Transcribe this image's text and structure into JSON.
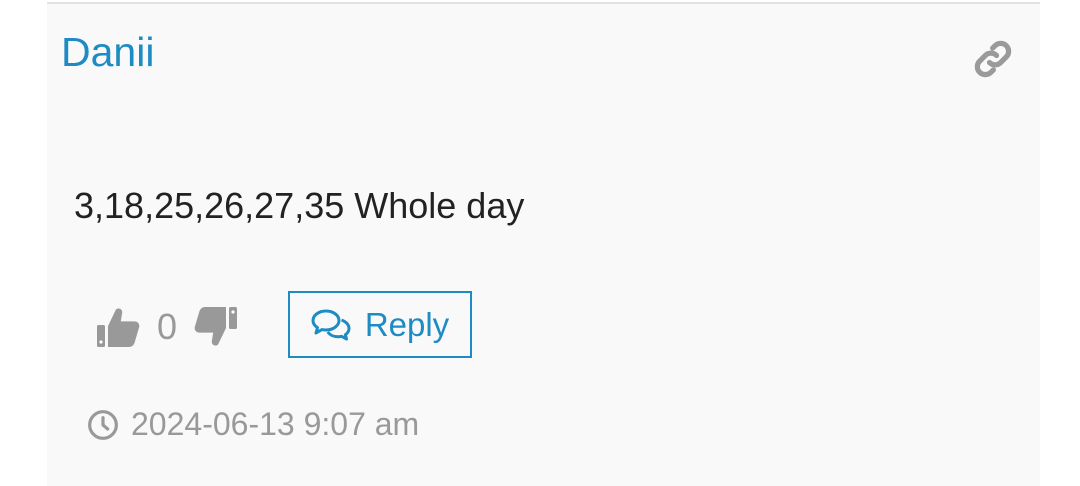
{
  "comment": {
    "author": "Danii",
    "body": "3,18,25,26,27,35 Whole day",
    "vote_count": "0",
    "reply_label": "Reply",
    "timestamp": "2024-06-13 9:07 am"
  },
  "icons": {
    "permalink": "link-icon",
    "upvote": "thumbs-up-icon",
    "downvote": "thumbs-down-icon",
    "reply": "comments-icon",
    "time": "clock-icon"
  },
  "colors": {
    "accent": "#1d8bc4",
    "muted": "#999999",
    "text": "#222222",
    "card_bg": "#f9f9f9"
  }
}
